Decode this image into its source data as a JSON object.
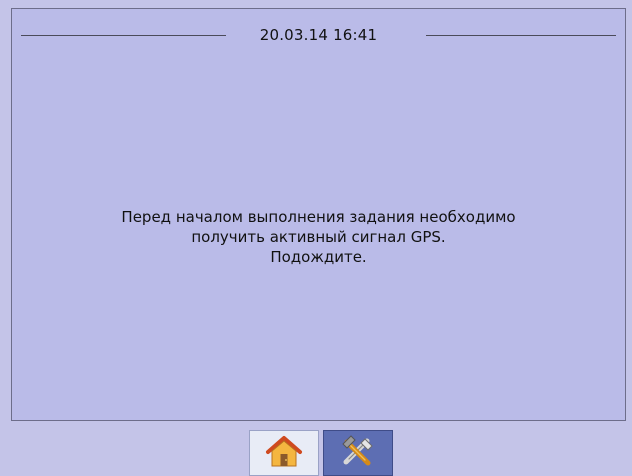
{
  "header": {
    "datetime": "20.03.14 16:41"
  },
  "message": {
    "line1": "Перед началом выполнения задания необходимо",
    "line2": "получить активный сигнал GPS.",
    "line3": "Подождите."
  },
  "toolbar": {
    "buttons": [
      {
        "icon": "home-icon",
        "selected": true
      },
      {
        "icon": "tools-icon",
        "selected": false
      }
    ]
  },
  "colors": {
    "background": "#c4c4e8",
    "panel": "#babbe8",
    "home_button_bg": "#e8ecf6",
    "tools_button_bg": "#5d6eb3"
  }
}
